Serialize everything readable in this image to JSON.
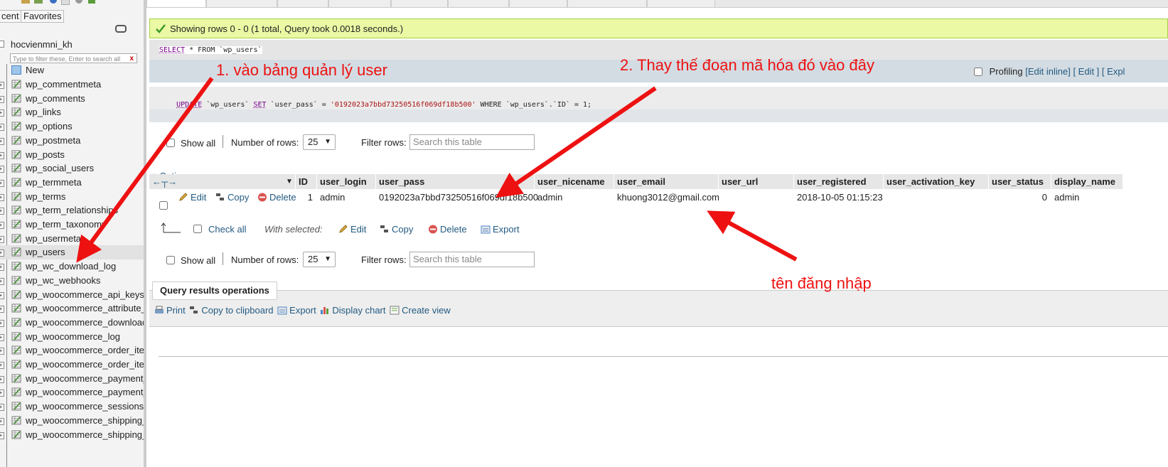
{
  "sidebar": {
    "tabs": [
      "cent",
      "Favorites"
    ],
    "database": "hocvienmni_kh",
    "filter_placeholder": "Type to filter these, Enter to search all",
    "filter_clear": "x",
    "new_label": "New",
    "tables": [
      "wp_commentmeta",
      "wp_comments",
      "wp_links",
      "wp_options",
      "wp_postmeta",
      "wp_posts",
      "wp_social_users",
      "wp_termmeta",
      "wp_terms",
      "wp_term_relationships",
      "wp_term_taxonomy",
      "wp_usermeta",
      "wp_users",
      "wp_wc_download_log",
      "wp_wc_webhooks",
      "wp_woocommerce_api_keys",
      "wp_woocommerce_attribute_",
      "wp_woocommerce_download",
      "wp_woocommerce_log",
      "wp_woocommerce_order_iter",
      "wp_woocommerce_order_iter",
      "wp_woocommerce_payment_",
      "wp_woocommerce_payment_",
      "wp_woocommerce_sessions",
      "wp_woocommerce_shipping_",
      "wp_woocommerce_shipping_"
    ],
    "selected_table": "wp_users"
  },
  "success_message": "Showing rows 0 - 0 (1 total, Query took 0.0018 seconds.)",
  "query": {
    "kw1": "SELECT",
    "rest": " * FROM `wp_users`"
  },
  "profiling": {
    "label": "Profiling",
    "links": [
      "[Edit inline]",
      "[ Edit ]",
      "[ Expl"
    ]
  },
  "update_sql": {
    "kw1": "UPDATE",
    "p1": " `wp_users` ",
    "kw2": "SET",
    "p2": " `user_pass` = ",
    "str": "'0192023a7bbd73250516f069df18b500'",
    "p3": " WHERE `wp_users`.`ID` = 1;"
  },
  "nav": {
    "show_all": "Show all",
    "num_rows_label": "Number of rows:",
    "num_rows_value": "25",
    "filter_label": "Filter rows:",
    "filter_placeholder": "Search this table"
  },
  "options_link": "+ Options",
  "table": {
    "columns": [
      "ID",
      "user_login",
      "user_pass",
      "user_nicename",
      "user_email",
      "user_url",
      "user_registered",
      "user_activation_key",
      "user_status",
      "display_name"
    ],
    "row": {
      "edit": "Edit",
      "copy": "Copy",
      "delete": "Delete",
      "ID": "1",
      "user_login": "admin",
      "user_pass": "0192023a7bbd73250516f069df18b500",
      "user_nicename": "admin",
      "user_email": "khuong3012@gmail.com",
      "user_url": "",
      "user_registered": "2018-10-05 01:15:23",
      "user_activation_key": "",
      "user_status": "0",
      "display_name": "admin"
    }
  },
  "bulk": {
    "check_all": "Check all",
    "with_selected": "With selected:",
    "edit": "Edit",
    "copy": "Copy",
    "delete": "Delete",
    "export": "Export"
  },
  "qro": {
    "legend": "Query results operations",
    "print": "Print",
    "copy_clipboard": "Copy to clipboard",
    "export": "Export",
    "display_chart": "Display chart",
    "create_view": "Create view"
  },
  "annotations": {
    "a1": "1. vào bảng quản lý user",
    "a2": "2. Thay thế đoạn mã hóa đó vào đây",
    "a3": "tên đăng nhập"
  },
  "colors": {
    "accent_link": "#235a81",
    "annotation": "#ee1111",
    "success_bg": "#ebf8a4",
    "keyword": "#770088"
  }
}
